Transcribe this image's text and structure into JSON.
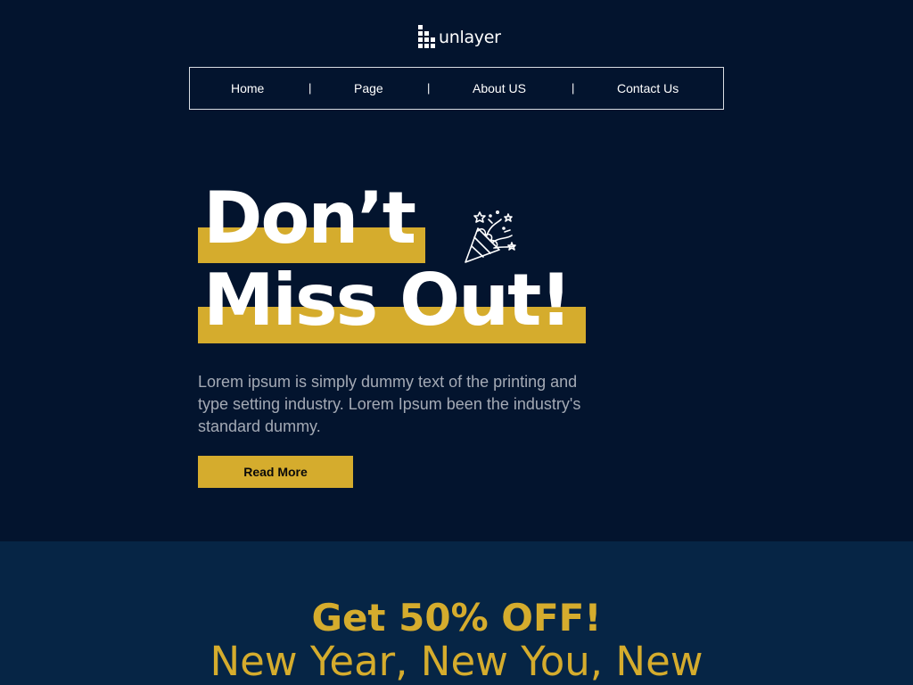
{
  "logo": {
    "text": "unlayer",
    "icon": "unlayer-logo-icon"
  },
  "nav": {
    "items": [
      {
        "label": "Home"
      },
      {
        "label": "Page"
      },
      {
        "label": "About US"
      },
      {
        "label": "Contact Us"
      }
    ],
    "separator": "|"
  },
  "hero": {
    "headline_line1": "Don’t",
    "headline_line2": "Miss Out!",
    "icon": "party-popper-icon",
    "body": "Lorem ipsum is simply dummy text of the printing and type setting industry. Lorem Ipsum been the industry's standard dummy.",
    "cta_label": "Read More"
  },
  "promo": {
    "title": "Get 50% OFF!",
    "subtitle": "New Year, New You, New"
  },
  "colors": {
    "background": "#03142e",
    "promo_background": "#062545",
    "accent": "#d5ac2d",
    "text": "#ffffff",
    "muted_text": "#a4aab5"
  }
}
